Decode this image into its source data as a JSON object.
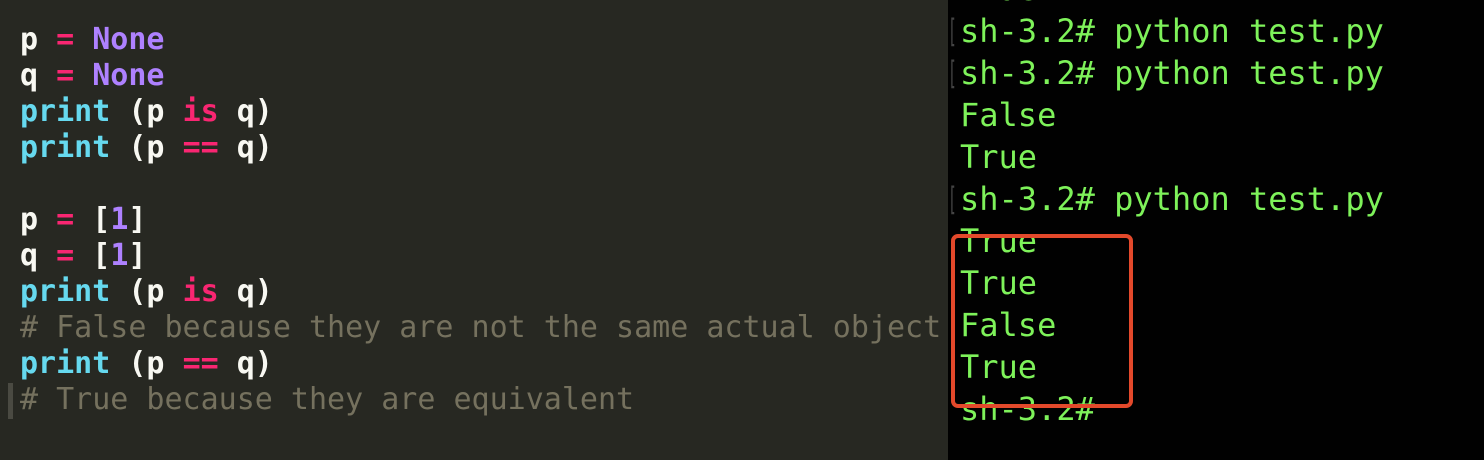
{
  "editor": {
    "lines": [
      [
        {
          "t": "p",
          "k": "var"
        },
        {
          "t": " ",
          "k": "var"
        },
        {
          "t": "=",
          "k": "op"
        },
        {
          "t": " ",
          "k": "var"
        },
        {
          "t": "None",
          "k": "const"
        }
      ],
      [
        {
          "t": "q",
          "k": "var"
        },
        {
          "t": " ",
          "k": "var"
        },
        {
          "t": "=",
          "k": "op"
        },
        {
          "t": " ",
          "k": "var"
        },
        {
          "t": "None",
          "k": "const"
        }
      ],
      [
        {
          "t": "print",
          "k": "func"
        },
        {
          "t": " (p ",
          "k": "punc"
        },
        {
          "t": "is",
          "k": "op"
        },
        {
          "t": " q)",
          "k": "punc"
        }
      ],
      [
        {
          "t": "print",
          "k": "func"
        },
        {
          "t": " (p ",
          "k": "punc"
        },
        {
          "t": "==",
          "k": "op"
        },
        {
          "t": " q)",
          "k": "punc"
        }
      ],
      [],
      [
        {
          "t": "p",
          "k": "var"
        },
        {
          "t": " ",
          "k": "var"
        },
        {
          "t": "=",
          "k": "op"
        },
        {
          "t": " [",
          "k": "punc"
        },
        {
          "t": "1",
          "k": "num"
        },
        {
          "t": "]",
          "k": "punc"
        }
      ],
      [
        {
          "t": "q",
          "k": "var"
        },
        {
          "t": " ",
          "k": "var"
        },
        {
          "t": "=",
          "k": "op"
        },
        {
          "t": " [",
          "k": "punc"
        },
        {
          "t": "1",
          "k": "num"
        },
        {
          "t": "]",
          "k": "punc"
        }
      ],
      [
        {
          "t": "print",
          "k": "func"
        },
        {
          "t": " (p ",
          "k": "punc"
        },
        {
          "t": "is",
          "k": "op"
        },
        {
          "t": " q)",
          "k": "punc"
        }
      ],
      [
        {
          "t": "# False because they are not the same actual object",
          "k": "cmt"
        }
      ],
      [
        {
          "t": "print",
          "k": "func"
        },
        {
          "t": " (p ",
          "k": "punc"
        },
        {
          "t": "==",
          "k": "op"
        },
        {
          "t": " q)",
          "k": "punc"
        }
      ],
      [
        {
          "t": "# True because they are equivalent",
          "k": "cmt"
        }
      ]
    ]
  },
  "terminal": {
    "lines": [
      {
        "text": "True",
        "prompt": false
      },
      {
        "text": "sh-3.2# python test.py",
        "prompt": true
      },
      {
        "text": "sh-3.2# python test.py",
        "prompt": true
      },
      {
        "text": "False",
        "prompt": false
      },
      {
        "text": "True",
        "prompt": false
      },
      {
        "text": "sh-3.2# python test.py",
        "prompt": true
      },
      {
        "text": "True",
        "prompt": false
      },
      {
        "text": "True",
        "prompt": false
      },
      {
        "text": "False",
        "prompt": false
      },
      {
        "text": "True",
        "prompt": false
      },
      {
        "text": "sh-3.2#",
        "prompt": false
      }
    ]
  },
  "colors": {
    "editor_bg": "#272822",
    "terminal_bg": "#010101",
    "terminal_text": "#7ef25a",
    "highlight_box": "#e3492b",
    "keyword_op": "#f92672",
    "constant": "#ae81ff",
    "function": "#66d9ef",
    "comment": "#75715e"
  }
}
